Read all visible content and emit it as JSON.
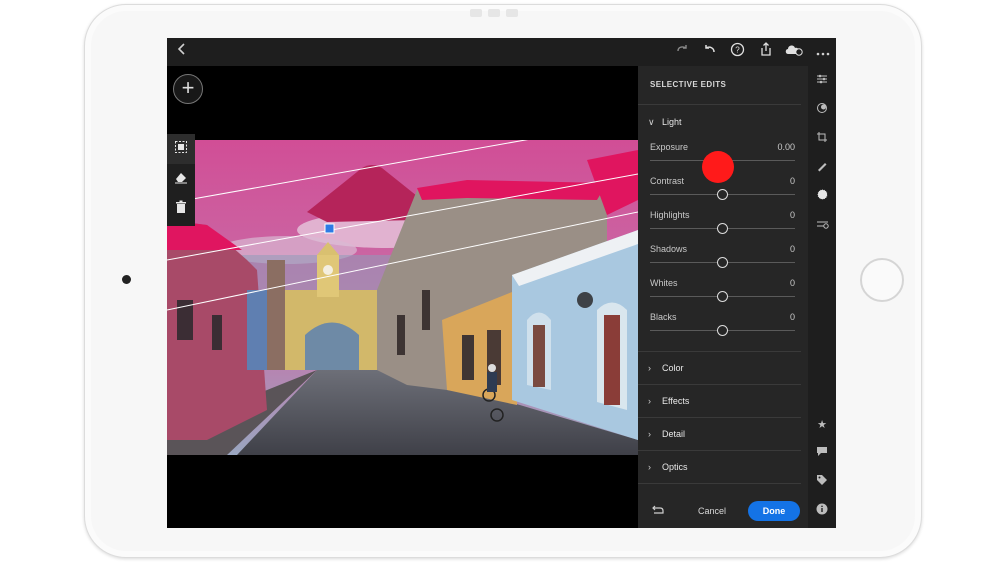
{
  "topbar": {
    "back_icon": "chevron-left-icon",
    "icons": [
      "redo-icon",
      "undo-icon",
      "help-icon",
      "share-icon",
      "cloud-sync-icon",
      "more-icon"
    ]
  },
  "left_tools": [
    "select-brush-icon",
    "eraser-icon",
    "trash-icon"
  ],
  "panel": {
    "title": "SELECTIVE EDITS",
    "light": {
      "label": "Light",
      "sliders": [
        {
          "label": "Exposure",
          "value": "0.00",
          "fraction": 0.5
        },
        {
          "label": "Contrast",
          "value": "0",
          "fraction": 0.5
        },
        {
          "label": "Highlights",
          "value": "0",
          "fraction": 0.5
        },
        {
          "label": "Shadows",
          "value": "0",
          "fraction": 0.5
        },
        {
          "label": "Whites",
          "value": "0",
          "fraction": 0.5
        },
        {
          "label": "Blacks",
          "value": "0",
          "fraction": 0.5
        }
      ]
    },
    "sections": [
      "Color",
      "Effects",
      "Detail",
      "Optics"
    ],
    "footer": {
      "cancel": "Cancel",
      "done": "Done"
    }
  },
  "right_rail_icons": [
    "edit-sliders-icon",
    "presets-icon",
    "crop-icon",
    "healing-icon",
    "selective-icon",
    "masking-icon",
    "star-icon",
    "comment-icon",
    "tag-icon",
    "info-icon"
  ],
  "colors": {
    "accent": "#1473e6",
    "touch_indicator": "#ff1a1a",
    "mask_overlay": "#e0156e"
  }
}
